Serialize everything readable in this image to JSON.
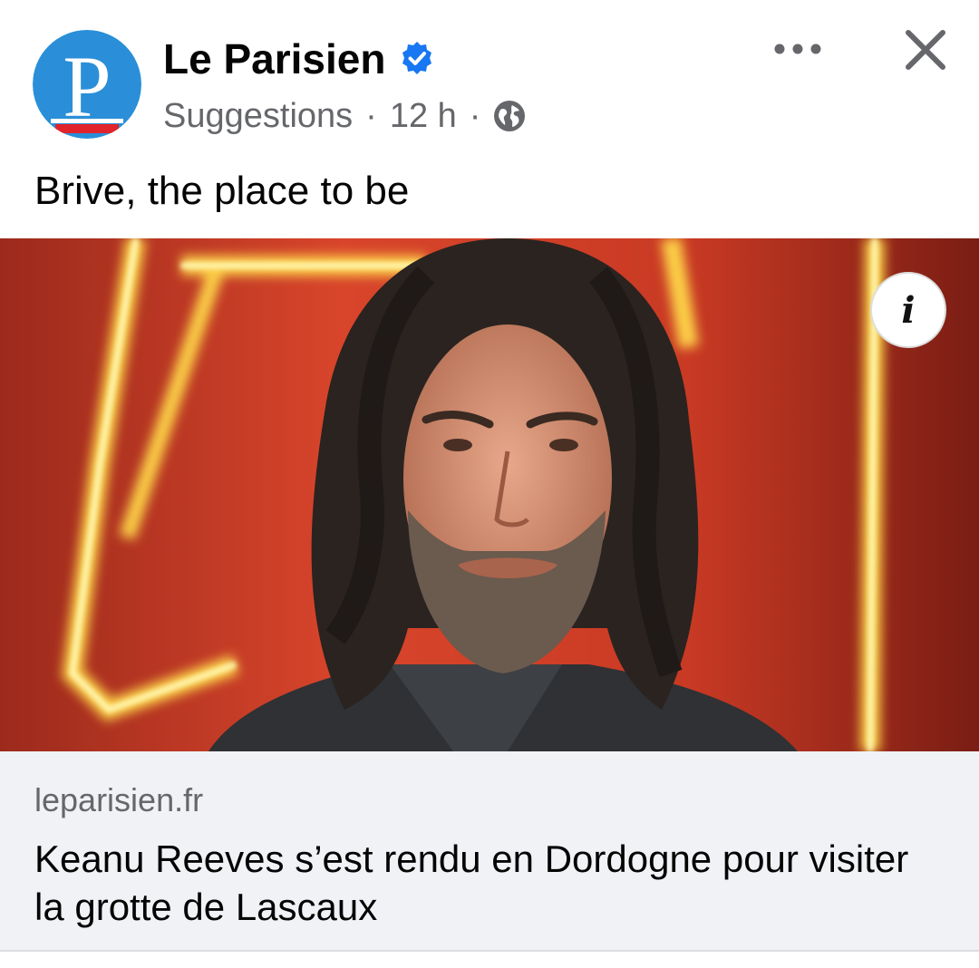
{
  "post": {
    "page_name": "Le Parisien",
    "avatar_letter": "P",
    "meta": {
      "label": "Suggestions",
      "separator": "·",
      "time": "12 h",
      "audience_icon": "globe-icon"
    },
    "more_icon": "more-options-icon",
    "close_icon": "close-icon",
    "caption": "Brive, the place to be",
    "media": {
      "info_label": "i"
    },
    "link": {
      "domain": "leparisien.fr",
      "headline": "Keanu Reeves s’est rendu en Dordogne pour visiter la grotte de Lascaux"
    }
  },
  "colors": {
    "brand_blue": "#2a8fd8",
    "brand_red": "#e1242b",
    "verified_blue": "#1877f2",
    "muted_text": "#65676b",
    "preview_bg": "#f0f2f5"
  }
}
